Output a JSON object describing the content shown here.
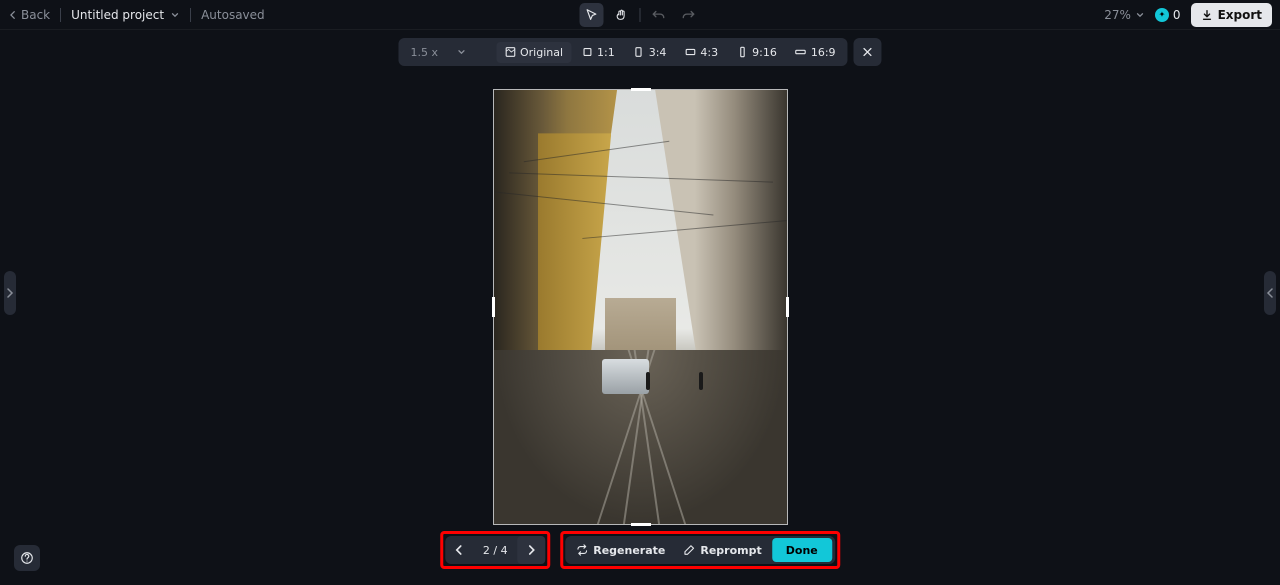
{
  "header": {
    "back_label": "Back",
    "project_title": "Untitled project",
    "autosave_status": "Autosaved",
    "zoom_value": "27%",
    "credits_value": "0",
    "export_label": "Export"
  },
  "aspect_bar": {
    "scale_label": "1.5 x",
    "items": [
      {
        "label": "Original",
        "icon": "original"
      },
      {
        "label": "1:1",
        "icon": "square"
      },
      {
        "label": "3:4",
        "icon": "portrait"
      },
      {
        "label": "4:3",
        "icon": "landscape"
      },
      {
        "label": "9:16",
        "icon": "tall"
      },
      {
        "label": "16:9",
        "icon": "wide"
      }
    ]
  },
  "pager": {
    "label": "2 / 4"
  },
  "actions": {
    "regenerate_label": "Regenerate",
    "reprompt_label": "Reprompt",
    "done_label": "Done"
  }
}
